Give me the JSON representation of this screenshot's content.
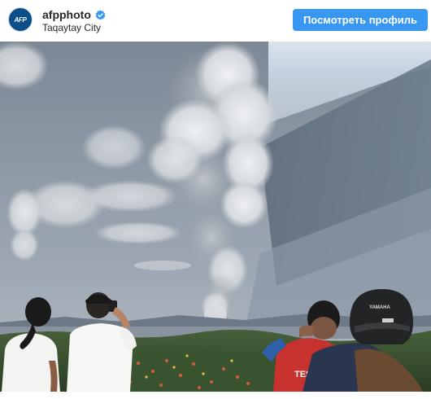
{
  "post": {
    "username": "afpphoto",
    "location": "Taqaytay City",
    "avatar_text": "AFP",
    "verified_icon": "verified-badge-icon",
    "profile_button_label": "Посмотреть профиль"
  },
  "colors": {
    "button": "#3897f0",
    "verified": "#3897f0",
    "avatar": "#0b4f8a"
  },
  "photo": {
    "description_icon": "volcano-eruption-photo",
    "helmet_text": "YAMAHA",
    "shirt_text": "TESTE"
  }
}
